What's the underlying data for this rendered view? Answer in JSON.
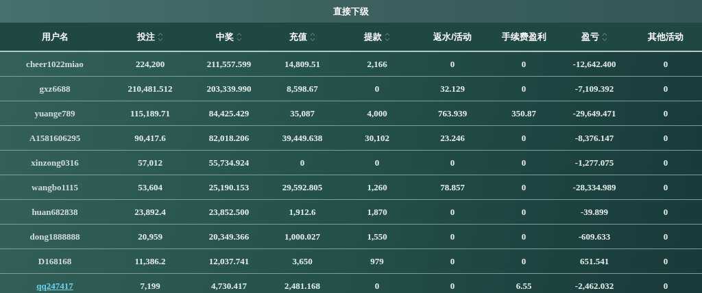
{
  "title": "直接下级",
  "table": {
    "columns": [
      {
        "label": "用户名",
        "sortable": false
      },
      {
        "label": "投注",
        "sortable": true
      },
      {
        "label": "中奖",
        "sortable": true
      },
      {
        "label": "充值",
        "sortable": true
      },
      {
        "label": "提款",
        "sortable": true
      },
      {
        "label": "返水/活动",
        "sortable": false
      },
      {
        "label": "手续费盈利",
        "sortable": false
      },
      {
        "label": "盈亏",
        "sortable": true
      },
      {
        "label": "其他活动",
        "sortable": false
      }
    ],
    "rows": [
      {
        "link": false,
        "cells": [
          "cheer1022miao",
          "224,200",
          "211,557.599",
          "14,809.51",
          "2,166",
          "0",
          "0",
          "-12,642.400",
          "0"
        ]
      },
      {
        "link": false,
        "cells": [
          "gxz6688",
          "210,481.512",
          "203,339.990",
          "8,598.67",
          "0",
          "32.129",
          "0",
          "-7,109.392",
          "0"
        ]
      },
      {
        "link": false,
        "cells": [
          "yuange789",
          "115,189.71",
          "84,425.429",
          "35,087",
          "4,000",
          "763.939",
          "350.87",
          "-29,649.471",
          "0"
        ]
      },
      {
        "link": false,
        "cells": [
          "A1581606295",
          "90,417.6",
          "82,018.206",
          "39,449.638",
          "30,102",
          "23.246",
          "0",
          "-8,376.147",
          "0"
        ]
      },
      {
        "link": false,
        "cells": [
          "xinzong0316",
          "57,012",
          "55,734.924",
          "0",
          "0",
          "0",
          "0",
          "-1,277.075",
          "0"
        ]
      },
      {
        "link": false,
        "cells": [
          "wangbo1115",
          "53,604",
          "25,190.153",
          "29,592.805",
          "1,260",
          "78.857",
          "0",
          "-28,334.989",
          "0"
        ]
      },
      {
        "link": false,
        "cells": [
          "huan682838",
          "23,892.4",
          "23,852.500",
          "1,912.6",
          "1,870",
          "0",
          "0",
          "-39.899",
          "0"
        ]
      },
      {
        "link": false,
        "cells": [
          "dong1888888",
          "20,959",
          "20,349.366",
          "1,000.027",
          "1,550",
          "0",
          "0",
          "-609.633",
          "0"
        ]
      },
      {
        "link": false,
        "cells": [
          "D168168",
          "11,386.2",
          "12,037.741",
          "3,650",
          "979",
          "0",
          "0",
          "651.541",
          "0"
        ]
      },
      {
        "link": true,
        "cells": [
          "qq247417",
          "7,199",
          "4,730.417",
          "2,481.168",
          "0",
          "0",
          "6.55",
          "-2,462.032",
          "0"
        ]
      }
    ]
  }
}
